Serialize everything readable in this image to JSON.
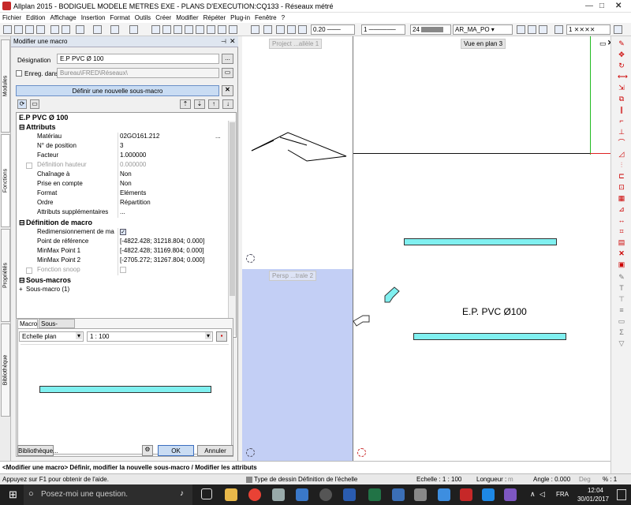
{
  "window": {
    "title": "Allplan 2015 - BODIGUEL MODELE METRES EXE - PLANS D'EXECUTION:CQ133 - Réseaux métré"
  },
  "menu": [
    "Fichier",
    "Edition",
    "Affichage",
    "Insertion",
    "Format",
    "Outils",
    "Créer",
    "Modifier",
    "Répéter",
    "Plug-in",
    "Fenêtre",
    "?"
  ],
  "toolbar": {
    "line_width": "0.20",
    "line_type": "1",
    "color_num": "24",
    "layer": "AR_MA_PO",
    "pattern_num": "1"
  },
  "left_tabs": [
    "Modules",
    "Fonctions",
    "Propriétés",
    "Bibliothèque"
  ],
  "panel": {
    "title": "Modifier une macro",
    "designation_label": "Désignation",
    "designation_value": "E.P PVC Ø 100",
    "enreg_label": "Enreg. dans",
    "enreg_value": "Bureau\\FRED\\Réseaux\\",
    "define_button": "Définir une nouvelle sous-macro",
    "tree_header": "E.P PVC Ø 100",
    "attributs_section": "Attributs",
    "attributes": [
      {
        "k": "Matériau",
        "v": "02GO161.212"
      },
      {
        "k": "N° de position",
        "v": "3"
      },
      {
        "k": "Facteur",
        "v": "1.000000"
      },
      {
        "k": "Définition hauteur",
        "v": "0.000000"
      },
      {
        "k": "Chaînage à",
        "v": "Non"
      },
      {
        "k": "Prise en compte",
        "v": "Non"
      },
      {
        "k": "Format",
        "v": "Eléments"
      },
      {
        "k": "Ordre",
        "v": "Répartition"
      },
      {
        "k": "Attributs supplémentaires",
        "v": "..."
      }
    ],
    "definition_section": "Définition de macro",
    "definition": [
      {
        "k": "Redimensionnement de ma",
        "v": ""
      },
      {
        "k": "Point de référence",
        "v": "[-4822.428; 31218.804; 0.000]"
      },
      {
        "k": "MinMax Point 1",
        "v": "[-4822.428; 31169.804; 0.000]"
      },
      {
        "k": "MinMax Point 2",
        "v": "[-2705.272; 31267.804; 0.000]"
      },
      {
        "k": "Fonction snoop",
        "v": ""
      }
    ],
    "sousmacros_section": "Sous-macros",
    "sousmacro_item": "Sous-macro (1)",
    "tabs": [
      "Macro",
      "Sous-macros"
    ],
    "echelle_label": "Echelle plan",
    "echelle_value": "1 : 100",
    "library_button": "Bibliothèque...",
    "ok_button": "OK",
    "cancel_button": "Annuler"
  },
  "views": {
    "project": "Project ...allèle 1",
    "persp": "Persp ...trale 2",
    "plan": "Vue en plan 3",
    "annotation": "E.P. PVC Ø100"
  },
  "status_message": "<Modifier une macro> Définir, modifier la nouvelle sous-macro / Modifier les attributs",
  "statusbar": {
    "help": "Appuyez sur F1 pour obtenir de l'aide.",
    "type_label": "Type de dessin :",
    "type_value": "Définition de l'échelle",
    "echelle": "Echelle : 1 : 100",
    "longueur": "Longueur :",
    "longueur_unit": "m",
    "angle": "Angle : 0.000",
    "angle_unit": "Deg",
    "percent": "% : 1"
  },
  "taskbar": {
    "search": "Posez-moi une question.",
    "lang": "FRA",
    "time": "12:04",
    "date": "30/01/2017"
  },
  "colors": {
    "accent": "#1f4e9c",
    "cyan": "#80f0f0",
    "perspective_bg": "#c3cff5",
    "taskbar": "#1f1f1f"
  }
}
